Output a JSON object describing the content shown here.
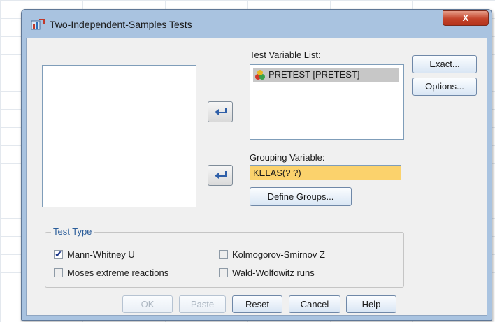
{
  "window": {
    "title": "Two-Independent-Samples Tests",
    "close_glyph": "X"
  },
  "test_variable_list": {
    "label": "Test Variable List:",
    "items": [
      "PRETEST [PRETEST]"
    ]
  },
  "grouping_variable": {
    "label": "Grouping Variable:",
    "value": "KELAS(? ?)"
  },
  "buttons": {
    "define_groups": "Define Groups...",
    "exact": "Exact...",
    "options": "Options...",
    "ok": "OK",
    "paste": "Paste",
    "reset": "Reset",
    "cancel": "Cancel",
    "help": "Help"
  },
  "test_type": {
    "title": "Test Type",
    "options": [
      {
        "label": "Mann-Whitney U",
        "checked": true
      },
      {
        "label": "Kolmogorov-Smirnov Z",
        "checked": false
      },
      {
        "label": "Moses extreme reactions",
        "checked": false
      },
      {
        "label": "Wald-Wolfowitz runs",
        "checked": false
      }
    ]
  },
  "colors": {
    "grouping_field_bg": "#fbd26c",
    "selected_item_bg": "#c7c7c7",
    "close_button": "#c3432a",
    "group_title": "#2b5d9a"
  },
  "icons": {
    "title": "dialog-app-icon",
    "variable": "scale-variable-icon",
    "move": "arrow-left-icon"
  }
}
